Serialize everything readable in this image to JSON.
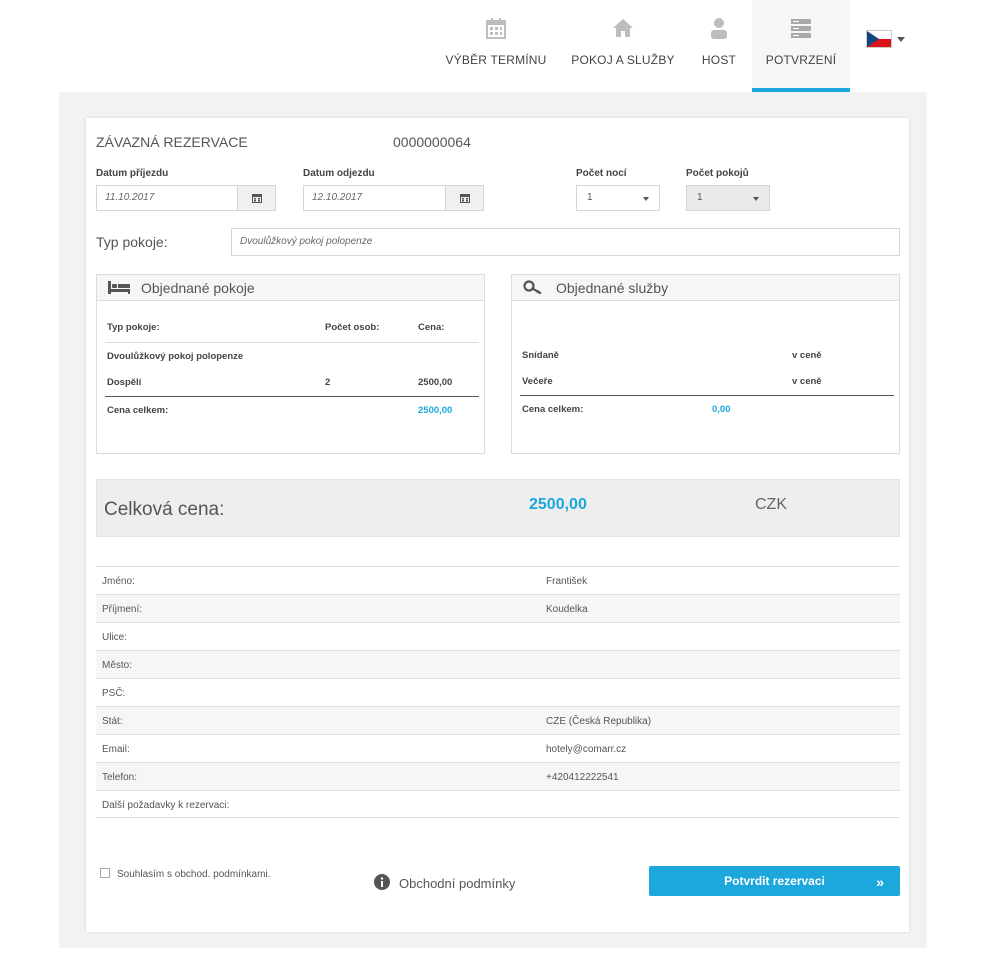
{
  "nav": {
    "items": [
      {
        "label": "VÝBĚR TERMÍNU",
        "icon": "calendar-icon"
      },
      {
        "label": "POKOJ A SLUŽBY",
        "icon": "home-icon"
      },
      {
        "label": "HOST",
        "icon": "user-icon"
      },
      {
        "label": "POTVRZENÍ",
        "icon": "server-icon",
        "active": true
      }
    ],
    "language_flag": "cz-flag-icon"
  },
  "header": {
    "title": "ZÁVAZNÁ REZERVACE",
    "reservation_number": "0000000064"
  },
  "form": {
    "arrival_label": "Datum příjezdu",
    "arrival_value": "11.10.2017",
    "departure_label": "Datum odjezdu",
    "departure_value": "12.10.2017",
    "nights_label": "Počet nocí",
    "nights_value": "1",
    "rooms_label": "Počet pokojů",
    "rooms_value": "1",
    "room_type_label": "Typ pokoje:",
    "room_type_value": "Dvoulůžkový pokoj polopenze"
  },
  "rooms_panel": {
    "title": "Objednané pokoje",
    "col_type": "Typ pokoje:",
    "col_persons": "Počet osob:",
    "col_price": "Cena:",
    "room_name": "Dvoulůžkový pokoj polopenze",
    "row_label": "Dospělí",
    "row_persons": "2",
    "row_price": "2500,00",
    "total_label": "Cena celkem:",
    "total_value": "2500,00"
  },
  "services_panel": {
    "title": "Objednané služby",
    "items": [
      {
        "name": "Snídaně",
        "price": "v ceně"
      },
      {
        "name": "Večeře",
        "price": "v ceně"
      }
    ],
    "total_label": "Cena celkem:",
    "total_value": "0,00"
  },
  "total": {
    "label": "Celková cena:",
    "value": "2500,00",
    "currency": "CZK"
  },
  "guest": {
    "rows": [
      {
        "label": "Jméno:",
        "value": "František"
      },
      {
        "label": "Příjmení:",
        "value": "Koudelka"
      },
      {
        "label": "Ulice:",
        "value": ""
      },
      {
        "label": "Město:",
        "value": ""
      },
      {
        "label": "PSČ:",
        "value": ""
      },
      {
        "label": "Stát:",
        "value": "CZE (Česká Republika)"
      },
      {
        "label": "Email:",
        "value": "hotely@comarr.cz"
      },
      {
        "label": "Telefon:",
        "value": "+420412222541"
      },
      {
        "label": "Další požadavky k rezervaci:",
        "value": ""
      }
    ]
  },
  "footer": {
    "agree_label": "Souhlasím s obchod. podmínkami.",
    "terms_label": "Obchodní podmínky",
    "confirm_label": "Potvrdit rezervaci",
    "confirm_arrow": "»"
  },
  "colors": {
    "accent": "#1ca8dd"
  }
}
